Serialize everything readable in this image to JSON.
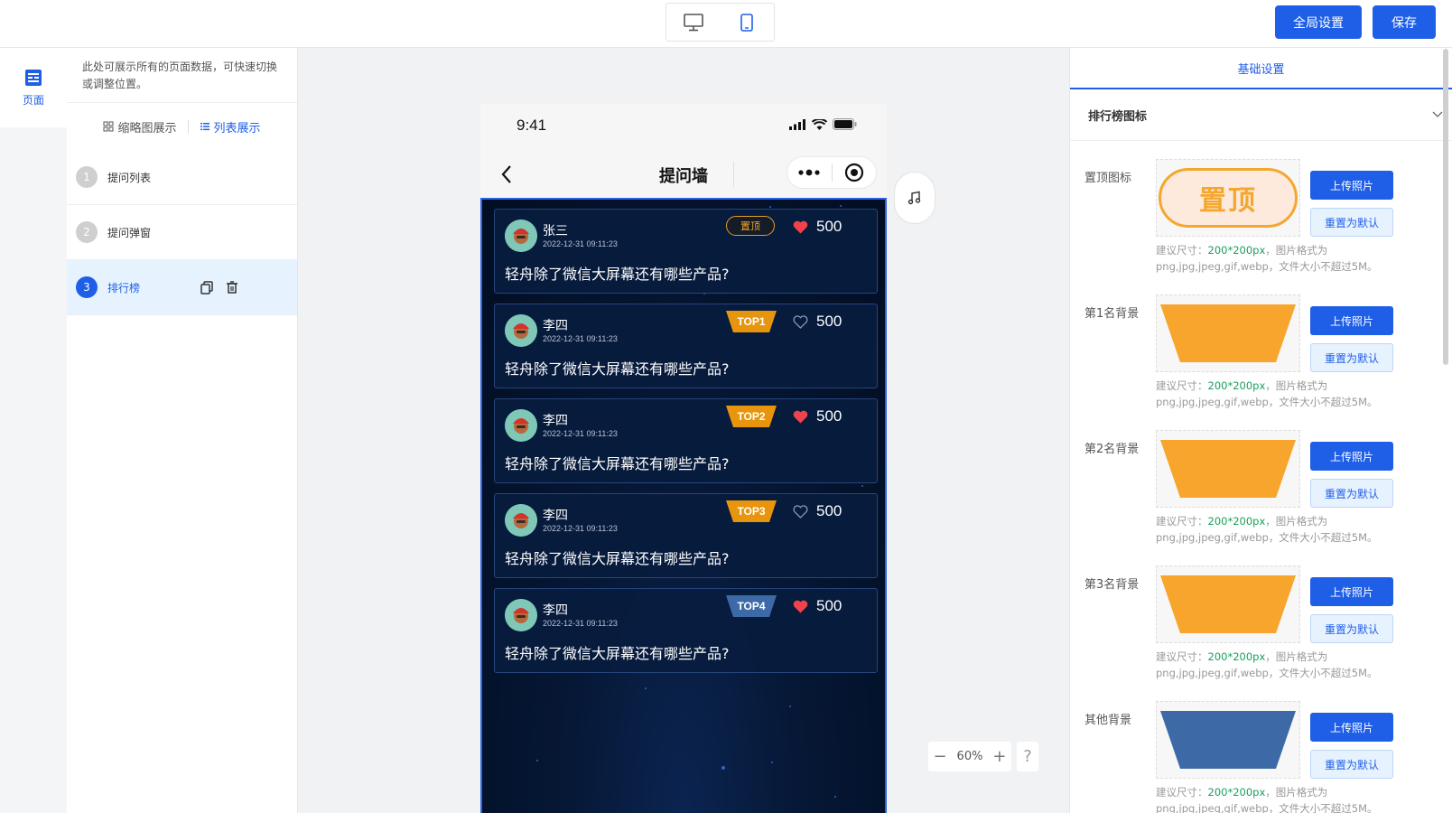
{
  "topbar": {
    "device_desktop_icon": "desktop-icon",
    "device_mobile_icon": "mobile-icon",
    "global_settings_label": "全局设置",
    "save_label": "保存"
  },
  "leftnav": {
    "pages_label": "页面"
  },
  "leftpanel": {
    "hint": "此处可展示所有的页面数据，可快速切换或调整位置。",
    "view_thumb_label": "缩略图展示",
    "view_list_label": "列表展示",
    "pages": [
      {
        "num": "1",
        "label": "提问列表"
      },
      {
        "num": "2",
        "label": "提问弹窗"
      },
      {
        "num": "3",
        "label": "排行榜"
      }
    ]
  },
  "phone": {
    "time": "9:41",
    "title": "提问墙",
    "cards": [
      {
        "name": "张三",
        "date": "2022-12-31 09:11:23",
        "badge": "置顶",
        "badge_type": "pin",
        "likes": "500",
        "liked": true,
        "question": "轻舟除了微信大屏幕还有哪些产品?"
      },
      {
        "name": "李四",
        "date": "2022-12-31 09:11:23",
        "badge": "TOP1",
        "badge_type": "gold",
        "likes": "500",
        "liked": false,
        "question": "轻舟除了微信大屏幕还有哪些产品?"
      },
      {
        "name": "李四",
        "date": "2022-12-31 09:11:23",
        "badge": "TOP2",
        "badge_type": "gold",
        "likes": "500",
        "liked": true,
        "question": "轻舟除了微信大屏幕还有哪些产品?"
      },
      {
        "name": "李四",
        "date": "2022-12-31 09:11:23",
        "badge": "TOP3",
        "badge_type": "gold",
        "likes": "500",
        "liked": false,
        "question": "轻舟除了微信大屏幕还有哪些产品?"
      },
      {
        "name": "李四",
        "date": "2022-12-31 09:11:23",
        "badge": "TOP4",
        "badge_type": "blue",
        "likes": "500",
        "liked": true,
        "question": "轻舟除了微信大屏幕还有哪些产品?"
      }
    ]
  },
  "zoom": {
    "minus": "−",
    "value": "60%",
    "plus": "+",
    "help": "?"
  },
  "rightpanel": {
    "tab": "基础设置",
    "section_title": "排行榜图标",
    "upload_label": "上传照片",
    "reset_label": "重置为默认",
    "tip_prefix": "建议尺寸：",
    "tip_size": "200*200px",
    "tip_suffix": "，图片格式为png,jpg,jpeg,gif,webp，文件大小不超过5M。",
    "pin_preview_text": "置顶",
    "rows": [
      {
        "label": "置顶图标",
        "preview": "pin"
      },
      {
        "label": "第1名背景",
        "preview": "orange"
      },
      {
        "label": "第2名背景",
        "preview": "orange"
      },
      {
        "label": "第3名背景",
        "preview": "orange"
      },
      {
        "label": "其他背景",
        "preview": "blue"
      }
    ]
  },
  "colors": {
    "primary": "#1f5fe8",
    "gold_badge": "#e8950e",
    "blue_badge": "#3d6aa6",
    "board_bg": "#02112a",
    "heart": "#f0424b"
  }
}
